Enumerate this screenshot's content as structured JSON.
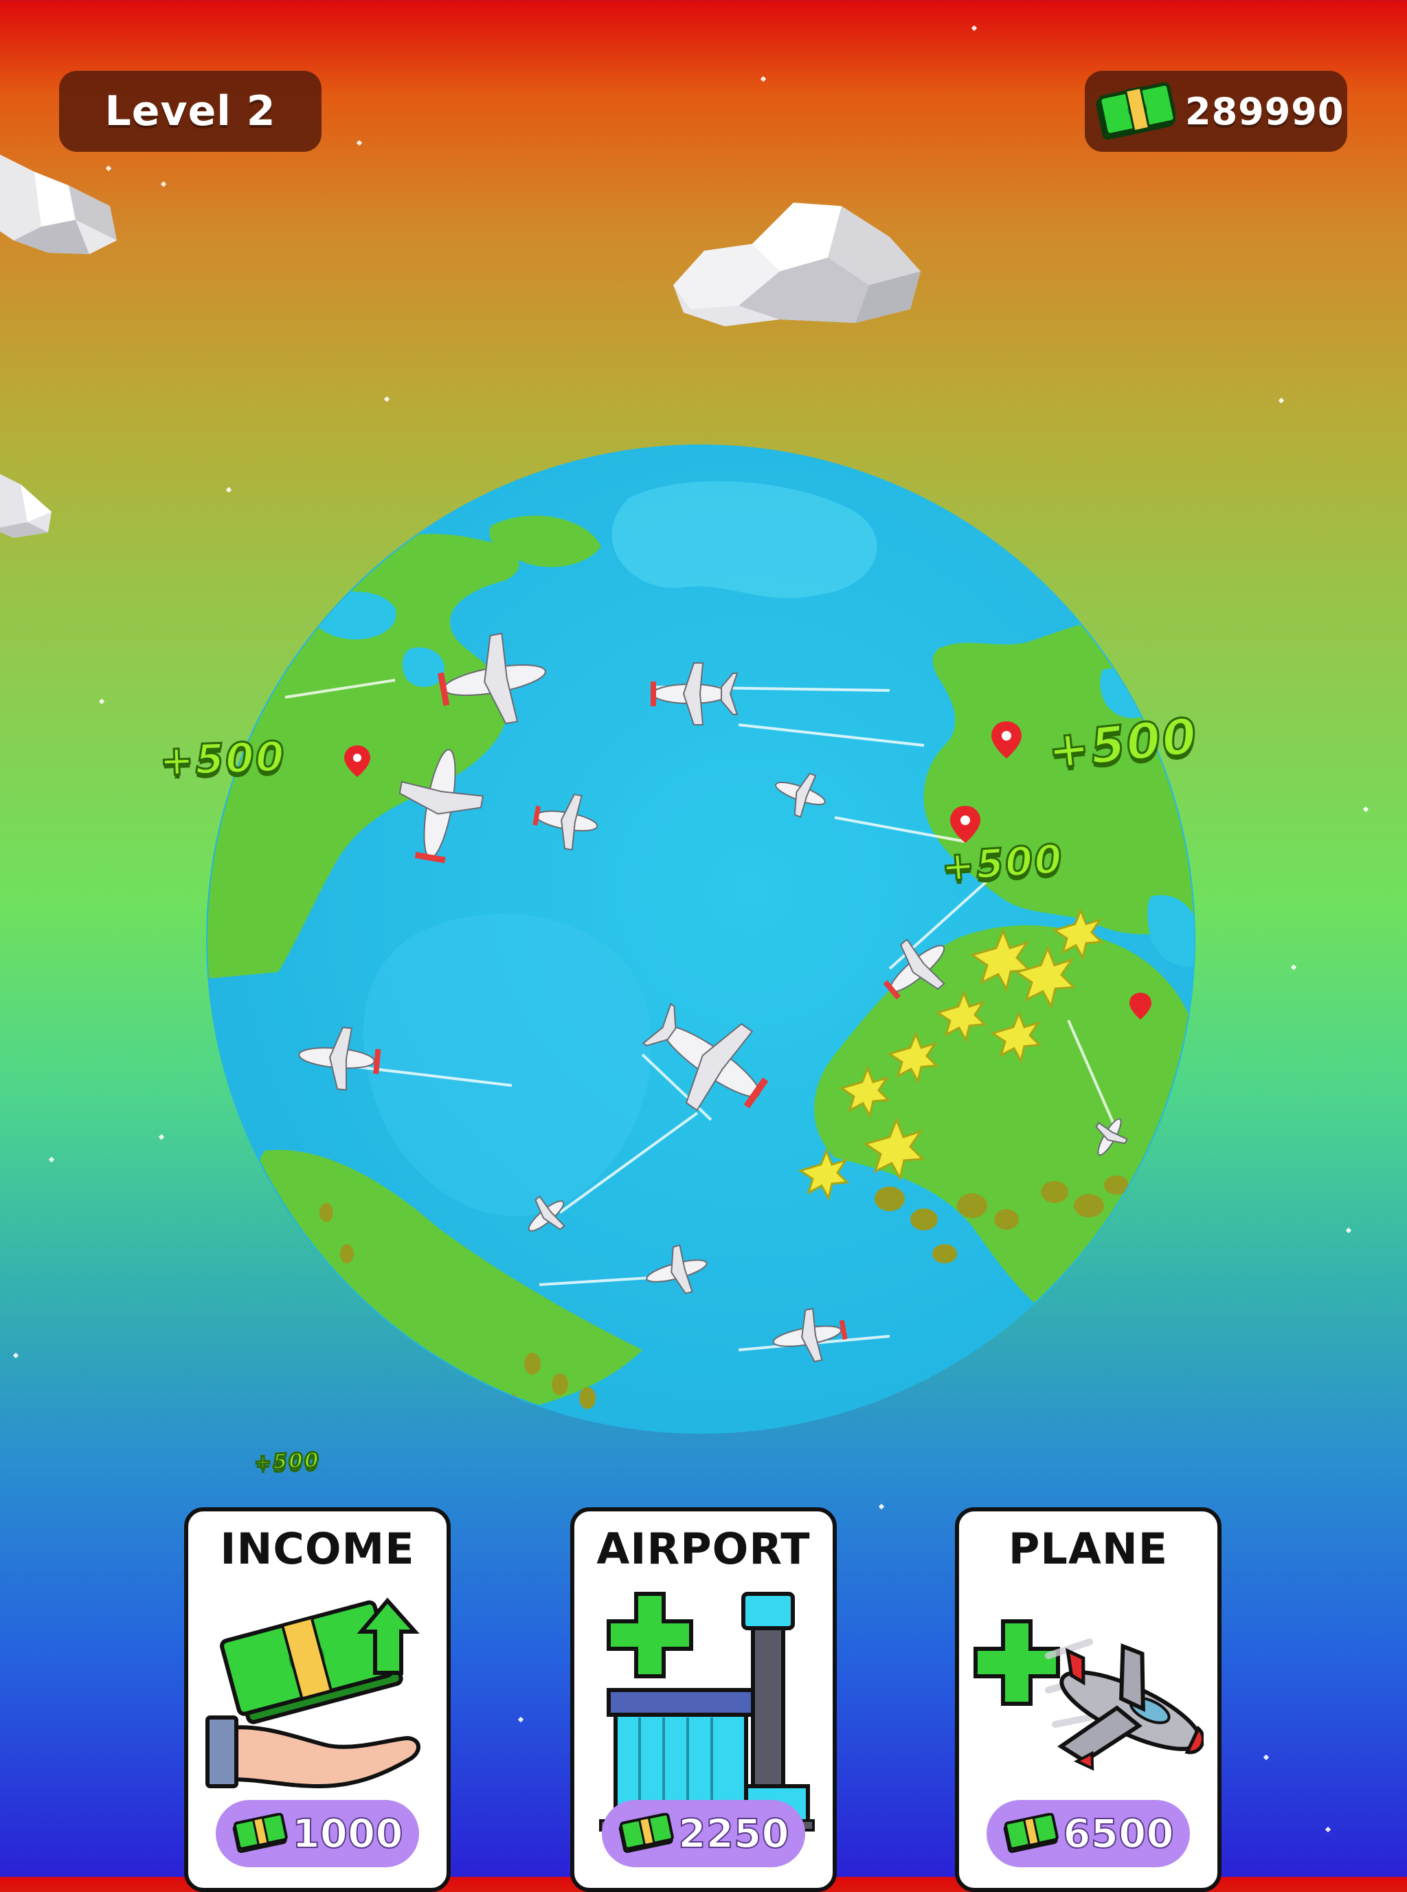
{
  "hud": {
    "level_label": "Level 2",
    "cash_amount": "289990",
    "cash_icon": "cash-stack-icon"
  },
  "floating_rewards": [
    "+500",
    "+500",
    "+500",
    "+500"
  ],
  "upgrades": [
    {
      "title": "INCOME",
      "price": "1000",
      "icon": "hand-with-cash-icon"
    },
    {
      "title": "AIRPORT",
      "price": "2250",
      "icon": "add-airport-icon"
    },
    {
      "title": "PLANE",
      "price": "6500",
      "icon": "add-plane-icon"
    }
  ],
  "colors": {
    "ocean": "#2bc3e8",
    "land": "#63c93a",
    "price_pill": "#b68af2",
    "reward_text": "#9cf02a",
    "hud_pill": "#5c1e0a"
  }
}
